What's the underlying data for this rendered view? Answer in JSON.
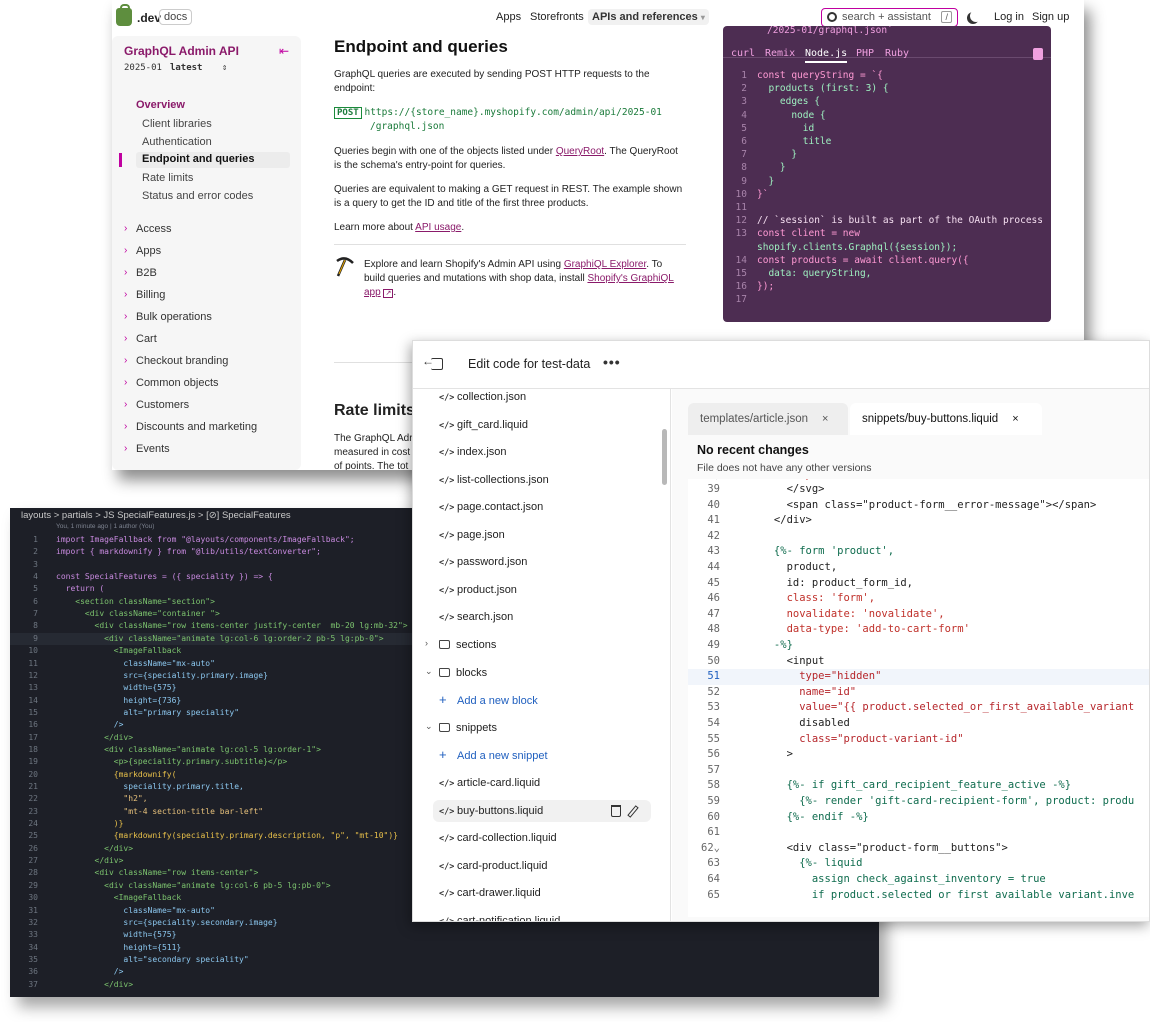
{
  "docs": {
    "brand": ".dev",
    "brand_badge": "docs",
    "nav": [
      "Apps",
      "Storefronts",
      "APIs and references"
    ],
    "search_placeholder": "search + assistant",
    "search_shortcut": "/",
    "login": "Log in",
    "signup": "Sign up",
    "sidebar": {
      "title": "GraphQL Admin API",
      "collapse_glyph": "⇤",
      "version": "2025-01",
      "version_tag": "latest",
      "version_glyph": "⇕",
      "overview": "Overview",
      "subitems": [
        "Client libraries",
        "Authentication",
        "Endpoint and queries",
        "Rate limits",
        "Status and error codes"
      ],
      "sections": [
        "Access",
        "Apps",
        "B2B",
        "Billing",
        "Bulk operations",
        "Cart",
        "Checkout branding",
        "Common objects",
        "Customers",
        "Discounts and marketing",
        "Events"
      ]
    },
    "content": {
      "title": "Endpoint and queries",
      "p1": "GraphQL queries are executed by sending POST HTTP requests to the endpoint:",
      "method": "POST",
      "url1": "https://{store_name}.myshopify.com/admin/api/2025-01",
      "url2": "/graphql.json",
      "p2_a": "Queries begin with one of the objects listed under ",
      "p2_link": "QueryRoot",
      "p2_b": ". The QueryRoot is the schema's entry-point for queries.",
      "p3": "Queries are equivalent to making a GET request in REST. The example shown is a query to get the ID and title of the first three products.",
      "p4_a": "Learn more about ",
      "p4_link": "API usage",
      "p4_b": ".",
      "explore_a": "Explore and learn Shopify's Admin API using ",
      "explore_link1": "GraphiQL Explorer",
      "explore_b": ". To build queries and mutations with shop data, install ",
      "explore_link2": "Shopify's GraphiQL app",
      "explore_c": ".",
      "rate_title": "Rate limits",
      "rate_p": "The GraphQL Adr",
      "rate_p2": "measured in cost",
      "rate_p3": "of points. The tot"
    },
    "code": {
      "top_partial": "/2025-01/graphql.json`",
      "tabs": [
        "curl",
        "Remix",
        "Node.js",
        "PHP",
        "Ruby"
      ],
      "active_tab": "Node.js",
      "lines": [
        {
          "n": "1",
          "t": "const queryString = `{"
        },
        {
          "n": "2",
          "t": "  products (first: 3) {"
        },
        {
          "n": "3",
          "t": "    edges {"
        },
        {
          "n": "4",
          "t": "      node {"
        },
        {
          "n": "5",
          "t": "        id"
        },
        {
          "n": "6",
          "t": "        title"
        },
        {
          "n": "7",
          "t": "      }"
        },
        {
          "n": "8",
          "t": "    }"
        },
        {
          "n": "9",
          "t": "  }"
        },
        {
          "n": "10",
          "t": "}`"
        },
        {
          "n": "11",
          "t": ""
        },
        {
          "n": "12",
          "t": "// `session` is built as part of the OAuth process"
        },
        {
          "n": "13",
          "t": "const client = new"
        },
        {
          "n": "",
          "t": "shopify.clients.Graphql({session});"
        },
        {
          "n": "14",
          "t": "const products = await client.query({"
        },
        {
          "n": "15",
          "t": "  data: queryString,"
        },
        {
          "n": "16",
          "t": "});"
        },
        {
          "n": "17",
          "t": ""
        }
      ]
    }
  },
  "vscode": {
    "breadcrumb": "layouts > partials > JS SpecialFeatures.js > [⊘] SpecialFeatures",
    "blame": "You, 1 minute ago | 1 author (You)",
    "lines": [
      {
        "n": "1",
        "t": "import ImageFallback from \"@layouts/components/ImageFallback\";"
      },
      {
        "n": "2",
        "t": "import { markdownify } from \"@lib/utils/textConverter\";"
      },
      {
        "n": "3",
        "t": ""
      },
      {
        "n": "4",
        "t": "const SpecialFeatures = ({ speciality }) => {"
      },
      {
        "n": "5",
        "t": "  return ("
      },
      {
        "n": "6",
        "t": "    <section className=\"section\">"
      },
      {
        "n": "7",
        "t": "      <div className=\"container \">"
      },
      {
        "n": "8",
        "t": "        <div className=\"row items-center justify-center  mb-20 lg:mb-32\">"
      },
      {
        "n": "9",
        "t": "          <div className=\"animate lg:col-6 lg:order-2 pb-5 lg:pb-0\">"
      },
      {
        "n": "10",
        "t": "            <ImageFallback"
      },
      {
        "n": "11",
        "t": "              className=\"mx-auto\""
      },
      {
        "n": "12",
        "t": "              src={speciality.primary.image}"
      },
      {
        "n": "13",
        "t": "              width={575}"
      },
      {
        "n": "14",
        "t": "              height={736}"
      },
      {
        "n": "15",
        "t": "              alt=\"primary speciality\""
      },
      {
        "n": "16",
        "t": "            />"
      },
      {
        "n": "17",
        "t": "          </div>"
      },
      {
        "n": "18",
        "t": "          <div className=\"animate lg:col-5 lg:order-1\">"
      },
      {
        "n": "19",
        "t": "            <p>{speciality.primary.subtitle}</p>"
      },
      {
        "n": "20",
        "t": "            {markdownify("
      },
      {
        "n": "21",
        "t": "              speciality.primary.title,"
      },
      {
        "n": "22",
        "t": "              \"h2\","
      },
      {
        "n": "23",
        "t": "              \"mt-4 section-title bar-left\""
      },
      {
        "n": "24",
        "t": "            )}"
      },
      {
        "n": "25",
        "t": "            {markdownify(speciality.primary.description, \"p\", \"mt-10\")}"
      },
      {
        "n": "26",
        "t": "          </div>"
      },
      {
        "n": "27",
        "t": "        </div>"
      },
      {
        "n": "28",
        "t": "        <div className=\"row items-center\">"
      },
      {
        "n": "29",
        "t": "          <div className=\"animate lg:col-6 pb-5 lg:pb-0\">"
      },
      {
        "n": "30",
        "t": "            <ImageFallback"
      },
      {
        "n": "31",
        "t": "              className=\"mx-auto\""
      },
      {
        "n": "32",
        "t": "              src={speciality.secondary.image}"
      },
      {
        "n": "33",
        "t": "              width={575}"
      },
      {
        "n": "34",
        "t": "              height={511}"
      },
      {
        "n": "35",
        "t": "              alt=\"secondary speciality\""
      },
      {
        "n": "36",
        "t": "            />"
      },
      {
        "n": "37",
        "t": "          </div>"
      }
    ]
  },
  "editor": {
    "title": "Edit code for test-data",
    "more_glyph": "•••",
    "files_top": [
      "collection.json",
      "gift_card.liquid",
      "index.json",
      "list-collections.json",
      "page.contact.json",
      "page.json",
      "password.json",
      "product.json",
      "search.json"
    ],
    "folder_sections": "sections",
    "folder_blocks": "blocks",
    "add_block": "Add a new block",
    "folder_snippets": "snippets",
    "add_snippet": "Add a new snippet",
    "snippet_files": [
      "article-card.liquid",
      "buy-buttons.liquid",
      "card-collection.liquid",
      "card-product.liquid",
      "cart-drawer.liquid",
      "cart-notification.liquid"
    ],
    "selected_file": "buy-buttons.liquid",
    "tabs": [
      {
        "label": "templates/article.json",
        "active": false
      },
      {
        "label_prefix": "snippets/",
        "label": "buy-buttons.liquid",
        "active": true
      }
    ],
    "close_glyph": "×",
    "no_recent": "No recent changes",
    "no_versions": "File does not have any other versions",
    "lines": [
      {
        "n": "39",
        "t": "        </svg>"
      },
      {
        "n": "40",
        "t": "        <span class=\"product-form__error-message\"></span>"
      },
      {
        "n": "41",
        "t": "      </div>"
      },
      {
        "n": "42",
        "t": ""
      },
      {
        "n": "43",
        "t": "      {%- form 'product',"
      },
      {
        "n": "44",
        "t": "        product,"
      },
      {
        "n": "45",
        "t": "        id: product_form_id,"
      },
      {
        "n": "46",
        "t": "        class: 'form',"
      },
      {
        "n": "47",
        "t": "        novalidate: 'novalidate',"
      },
      {
        "n": "48",
        "t": "        data-type: 'add-to-cart-form'"
      },
      {
        "n": "49",
        "t": "      -%}"
      },
      {
        "n": "50",
        "t": "        <input"
      },
      {
        "n": "51",
        "t": "          type=\"hidden\""
      },
      {
        "n": "52",
        "t": "          name=\"id\""
      },
      {
        "n": "53",
        "t": "          value=\"{{ product.selected_or_first_available_variant"
      },
      {
        "n": "54",
        "t": "          disabled"
      },
      {
        "n": "55",
        "t": "          class=\"product-variant-id\""
      },
      {
        "n": "56",
        "t": "        >"
      },
      {
        "n": "57",
        "t": ""
      },
      {
        "n": "58",
        "t": "        {%- if gift_card_recipient_feature_active -%}"
      },
      {
        "n": "59",
        "t": "          {%- render 'gift-card-recipient-form', product: produ"
      },
      {
        "n": "60",
        "t": "        {%- endif -%}"
      },
      {
        "n": "61",
        "t": ""
      },
      {
        "n": "62",
        "t": "        <div class=\"product-form__buttons\">"
      },
      {
        "n": "63",
        "t": "          {%- liquid"
      },
      {
        "n": "64",
        "t": "            assign check_against_inventory = true"
      },
      {
        "n": "65",
        "t": "            if product.selected or first available variant.inve"
      }
    ],
    "current_line": "51"
  },
  "colors": {
    "accent": "#c000a0",
    "code_bg": "#4d2d52",
    "vscode_bg": "#1d1f27",
    "shopify_green": "#5e8e3e"
  }
}
